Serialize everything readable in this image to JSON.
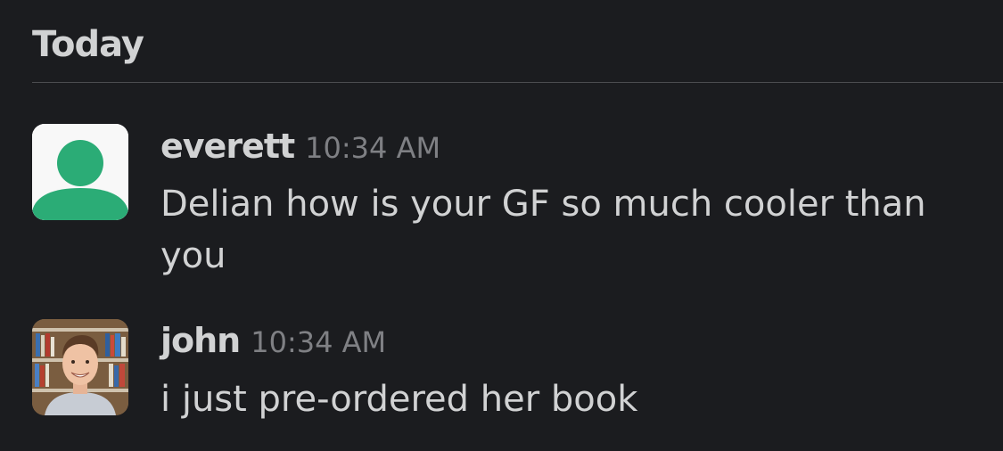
{
  "day_header": "Today",
  "messages": [
    {
      "sender": "everett",
      "time": "10:34 AM",
      "text": "Delian how is your GF so much cooler than you",
      "avatar": "default-user-icon"
    },
    {
      "sender": "john",
      "time": "10:34 AM",
      "text": "i just pre-ordered her book",
      "avatar": "user-photo"
    }
  ],
  "colors": {
    "background": "#1b1c1f",
    "text": "#d1d2d3",
    "timestamp": "#7f8084",
    "default_avatar": "#2bac76"
  }
}
